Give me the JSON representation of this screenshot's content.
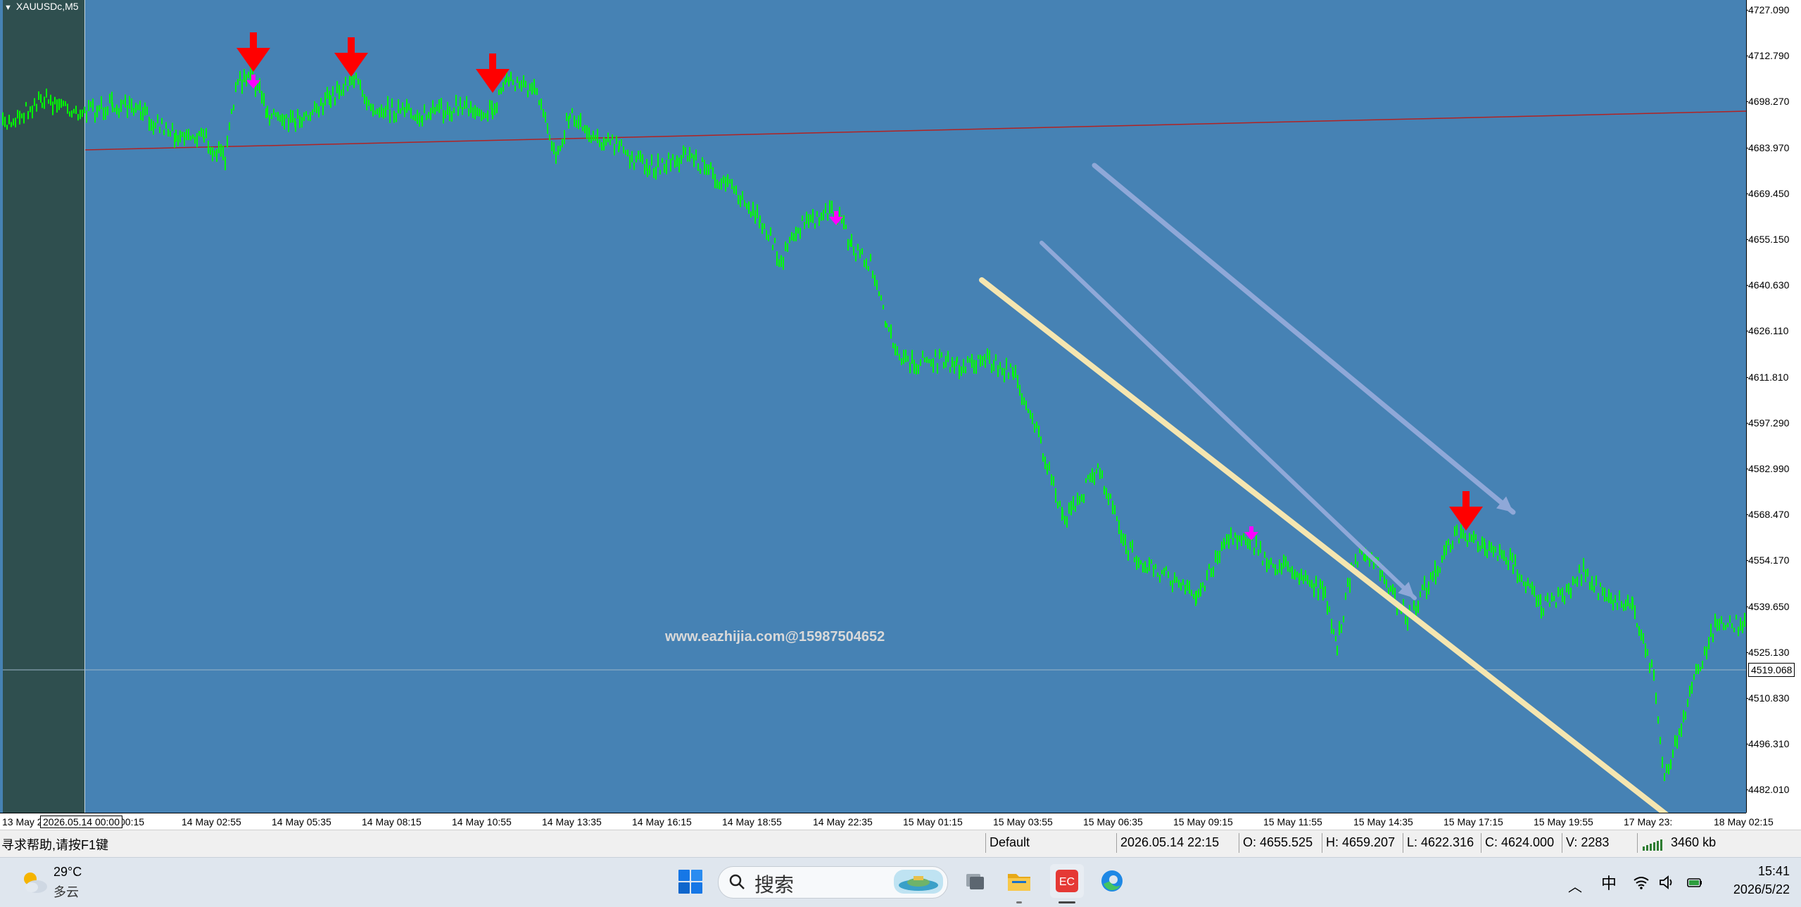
{
  "chart": {
    "symbol": "XAUUSDc,M5",
    "watermark": "www.eazhijia.com@15987504652",
    "current_price": "4519.068",
    "price_ticks": [
      "4727.090",
      "4712.790",
      "4698.270",
      "4683.970",
      "4669.450",
      "4655.150",
      "4640.630",
      "4626.110",
      "4611.810",
      "4597.290",
      "4582.990",
      "4568.470",
      "4554.170",
      "4539.650",
      "4525.130",
      "4510.830",
      "4496.310",
      "4482.010"
    ],
    "time_ticks": [
      "13 May 2",
      "00:15",
      "14 May 02:55",
      "14 May 05:35",
      "14 May 08:15",
      "14 May 10:55",
      "14 May 13:35",
      "14 May 16:15",
      "14 May 18:55",
      "14 May 22:35",
      "15 May 01:15",
      "15 May 03:55",
      "15 May 06:35",
      "15 May 09:15",
      "15 May 11:55",
      "15 May 14:35",
      "15 May 17:15",
      "15 May 19:55",
      "17 May 23:",
      "18 May 02:15"
    ],
    "time_highlight": "2026.05.14 00:00",
    "colors": {
      "background": "#4682b4",
      "candles": "#00ff00",
      "trendline": "#b22222",
      "signal_arrow_big": "#ff0000",
      "signal_arrow_small": "#ff00ff",
      "annotation_arrow_light": "#8fa8d8",
      "annotation_arrow_cream": "#f5e6b0"
    }
  },
  "status": {
    "help": "寻求帮助,请按F1键",
    "profile": "Default",
    "datetime": "2026.05.14 22:15",
    "open": "O: 4655.525",
    "high": "H: 4659.207",
    "low": "L: 4622.316",
    "close": "C: 4624.000",
    "volume": "V: 2283",
    "traffic": "3460",
    "traffic_unit": "kb"
  },
  "taskbar": {
    "weather_temp": "29°C",
    "weather_desc": "多云",
    "search_placeholder": "搜索",
    "ime": "中",
    "time": "15:41",
    "date": "2026/5/22",
    "apps": [
      "start-menu",
      "search",
      "task-view",
      "file-explorer",
      "ec-trading-terminal",
      "edge-browser"
    ]
  }
}
